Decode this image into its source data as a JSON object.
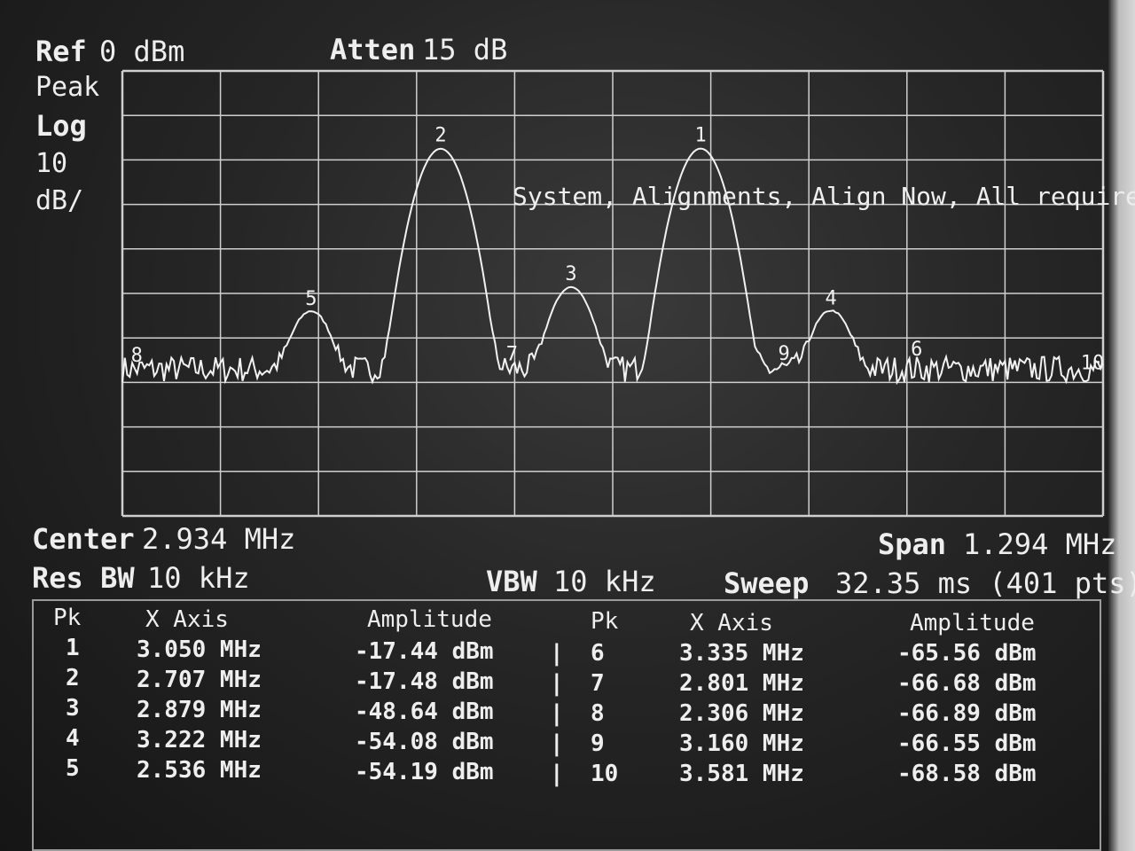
{
  "header": {
    "ref_label": "Ref",
    "ref_value": "0 dBm",
    "atten_label": "Atten",
    "atten_value": "15 dB",
    "detector": "Peak",
    "scale_type": "Log",
    "scale_value": "10",
    "scale_unit": "dB/"
  },
  "message": "System, Alignments, Align Now, All required",
  "footer": {
    "center_label": "Center",
    "center_value": "2.934 MHz",
    "span_label": "Span",
    "span_value": "1.294 MHz",
    "rbw_label": "Res BW",
    "rbw_value": "10 kHz",
    "vbw_label": "VBW",
    "vbw_value": "10 kHz",
    "sweep_label": "Sweep",
    "sweep_value": "32.35 ms (401 pts)"
  },
  "table": {
    "headers": [
      "Pk",
      "X Axis",
      "Amplitude"
    ],
    "divider": "|",
    "left": [
      {
        "pk": "1",
        "x": "3.050 MHz",
        "amp": "-17.44 dBm"
      },
      {
        "pk": "2",
        "x": "2.707 MHz",
        "amp": "-17.48 dBm"
      },
      {
        "pk": "3",
        "x": "2.879 MHz",
        "amp": "-48.64 dBm"
      },
      {
        "pk": "4",
        "x": "3.222 MHz",
        "amp": "-54.08 dBm"
      },
      {
        "pk": "5",
        "x": "2.536 MHz",
        "amp": "-54.19 dBm"
      }
    ],
    "right": [
      {
        "pk": "6",
        "x": "3.335 MHz",
        "amp": "-65.56 dBm"
      },
      {
        "pk": "7",
        "x": "2.801 MHz",
        "amp": "-66.68 dBm"
      },
      {
        "pk": "8",
        "x": "2.306 MHz",
        "amp": "-66.89 dBm"
      },
      {
        "pk": "9",
        "x": "3.160 MHz",
        "amp": "-66.55 dBm"
      },
      {
        "pk": "10",
        "x": "3.581 MHz",
        "amp": "-68.58 dBm"
      }
    ]
  },
  "chart_data": {
    "type": "line",
    "title": "",
    "xlim": [
      2.287,
      3.581
    ],
    "ylim": [
      -100,
      0
    ],
    "y_scale": "Log 10 dB/div",
    "grid": true,
    "noise_floor_dbm": -67,
    "series": [
      {
        "color": "#f2f2f2",
        "markers": [
          {
            "label": "1",
            "x": 3.05,
            "y": -17.44
          },
          {
            "label": "2",
            "x": 2.707,
            "y": -17.48
          },
          {
            "label": "3",
            "x": 2.879,
            "y": -48.64
          },
          {
            "label": "4",
            "x": 3.222,
            "y": -54.08
          },
          {
            "label": "5",
            "x": 2.536,
            "y": -54.19
          },
          {
            "label": "6",
            "x": 3.335,
            "y": -65.56
          },
          {
            "label": "7",
            "x": 2.801,
            "y": -66.68
          },
          {
            "label": "8",
            "x": 2.306,
            "y": -66.89
          },
          {
            "label": "9",
            "x": 3.16,
            "y": -66.55
          },
          {
            "label": "10",
            "x": 3.581,
            "y": -68.58
          }
        ]
      }
    ]
  }
}
